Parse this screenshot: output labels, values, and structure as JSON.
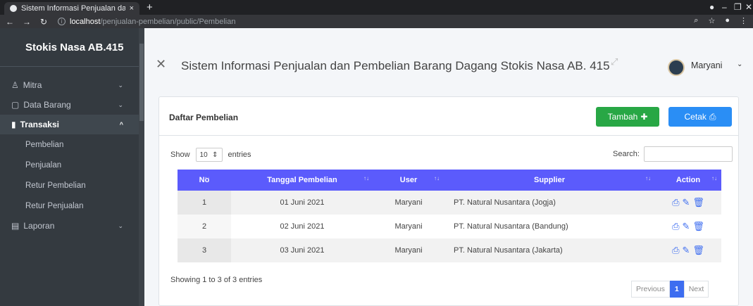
{
  "browser": {
    "tab_title": "Sistem Informasi Penjualan dan P",
    "tab_close": "×",
    "new_tab": "+",
    "url_host": "localhost",
    "url_path": "/penjualan-pembelian/public/Pembelian"
  },
  "sidebar": {
    "brand": "Stokis Nasa AB.415",
    "items": [
      {
        "label": "Mitra",
        "icon": "user-icon"
      },
      {
        "label": "Data Barang",
        "icon": "box-icon"
      },
      {
        "label": "Transaksi",
        "icon": "chart-icon"
      },
      {
        "label": "Laporan",
        "icon": "report-icon"
      }
    ],
    "subitems": [
      "Pembelian",
      "Penjualan",
      "Retur Pembelian",
      "Retur Penjualan"
    ]
  },
  "header": {
    "title": "Sistem Informasi Penjualan dan Pembelian Barang Dagang Stokis Nasa AB. 415",
    "user": "Maryani"
  },
  "card": {
    "title": "Daftar Pembelian",
    "add_label": "Tambah",
    "print_label": "Cetak"
  },
  "table_controls": {
    "show": "Show",
    "entries_value": "10",
    "entries": "entries",
    "search": "Search:"
  },
  "table": {
    "headers": [
      "No",
      "Tanggal Pembelian",
      "User",
      "Supplier",
      "Action"
    ],
    "rows": [
      {
        "no": "1",
        "date": "01 Juni 2021",
        "user": "Maryani",
        "supplier": "PT. Natural Nusantara (Jogja)"
      },
      {
        "no": "2",
        "date": "02 Juni 2021",
        "user": "Maryani",
        "supplier": "PT. Natural Nusantara (Bandung)"
      },
      {
        "no": "3",
        "date": "03 Juni 2021",
        "user": "Maryani",
        "supplier": "PT. Natural Nusantara (Jakarta)"
      }
    ]
  },
  "footer": {
    "info": "Showing 1 to 3 of 3 entries",
    "previous": "Previous",
    "page": "1",
    "next": "Next"
  },
  "colors": {
    "sidebar_bg": "#343a40",
    "table_header": "#5b5bfc",
    "add_button": "#28a745",
    "print_button": "#2a8ef5"
  }
}
